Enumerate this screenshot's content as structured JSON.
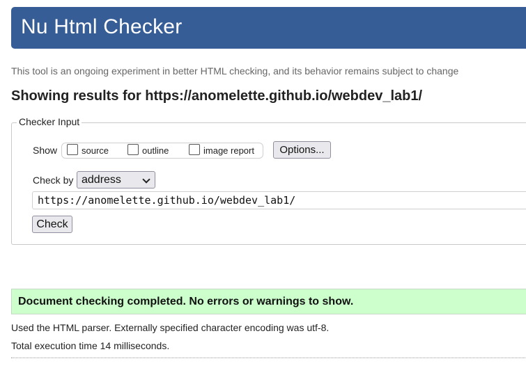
{
  "header": {
    "title": "Nu Html Checker"
  },
  "intro_text": "This tool is an ongoing experiment in better HTML checking, and its behavior remains subject to change",
  "results_heading": "Showing results for https://anomelette.github.io/webdev_lab1/",
  "checker_input": {
    "legend": "Checker Input",
    "show_label": "Show",
    "show_options": [
      {
        "label": "source",
        "checked": false
      },
      {
        "label": "outline",
        "checked": false
      },
      {
        "label": "image report",
        "checked": false
      }
    ],
    "options_button": "Options...",
    "check_by_label": "Check by",
    "check_by_value": "address",
    "url_value": "https://anomelette.github.io/webdev_lab1/",
    "check_button": "Check"
  },
  "result": {
    "message": "Document checking completed. No errors or warnings to show.",
    "parser_info": "Used the HTML parser. Externally specified character encoding was utf-8.",
    "execution_time": "Total execution time 14 milliseconds."
  },
  "colors": {
    "header_bg": "#365d95",
    "success_bg": "#ccffcc"
  }
}
